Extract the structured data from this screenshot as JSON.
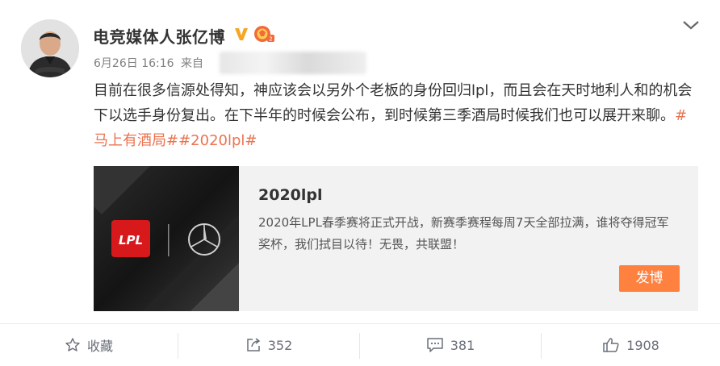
{
  "header": {
    "username": "电竞媒体人张亿博",
    "date": "6月26日",
    "time": "16:16",
    "source_prefix": "来自"
  },
  "post": {
    "text": "目前在很多信源处得知，神应该会以另外个老板的身份回归lpl，而且会在天时地利人和的机会下以选手身份复出。在下半年的时候会公布，到时候第三季酒局时候我们也可以展开来聊。",
    "hashtags": "#马上有酒局##2020lpl#"
  },
  "link_card": {
    "title": "2020lpl",
    "description": "2020年LPL春季赛将正式开战，新赛季赛程每周7天全部拉满，谁将夺得冠军奖杯，我们拭目以待！无畏，共联盟！",
    "button_label": "发博",
    "logo_text": "LPL"
  },
  "actions": {
    "favorite_label": "收藏",
    "repost_count": "352",
    "comment_count": "381",
    "like_count": "1908"
  },
  "colors": {
    "hashtag": "#eb7350",
    "button": "#ff8140",
    "verified": "#f5a623"
  }
}
